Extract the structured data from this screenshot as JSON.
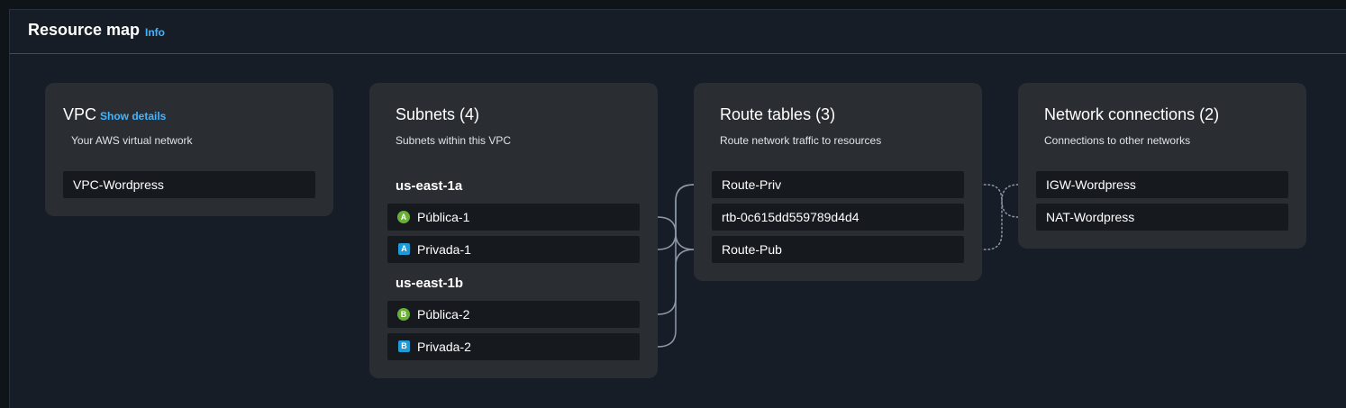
{
  "header": {
    "title": "Resource map",
    "info_label": "Info"
  },
  "vpc": {
    "title": "VPC",
    "show_details": "Show details",
    "description": "Your AWS virtual network",
    "items": [
      "VPC-Wordpress"
    ]
  },
  "subnets": {
    "title": "Subnets (4)",
    "description": "Subnets within this VPC",
    "groups": [
      {
        "zone": "us-east-1a",
        "items": [
          {
            "badge": "A",
            "type": "public",
            "label": "Pública-1"
          },
          {
            "badge": "A",
            "type": "private",
            "label": "Privada-1"
          }
        ]
      },
      {
        "zone": "us-east-1b",
        "items": [
          {
            "badge": "B",
            "type": "public",
            "label": "Pública-2"
          },
          {
            "badge": "B",
            "type": "private",
            "label": "Privada-2"
          }
        ]
      }
    ]
  },
  "route_tables": {
    "title": "Route tables (3)",
    "description": "Route network traffic to resources",
    "items": [
      "Route-Priv",
      "rtb-0c615dd559789d4d4",
      "Route-Pub"
    ]
  },
  "network_connections": {
    "title": "Network connections (2)",
    "description": "Connections to other networks",
    "items": [
      "IGW-Wordpress",
      "NAT-Wordpress"
    ]
  },
  "colors": {
    "background": "#0f1419",
    "panel": "#161d26",
    "card": "#2a2e33",
    "item": "#161a1f",
    "link": "#42b4ff",
    "public_badge": "#6aaf35",
    "private_badge": "#1d9bd9",
    "connector": "#8d99a8"
  }
}
